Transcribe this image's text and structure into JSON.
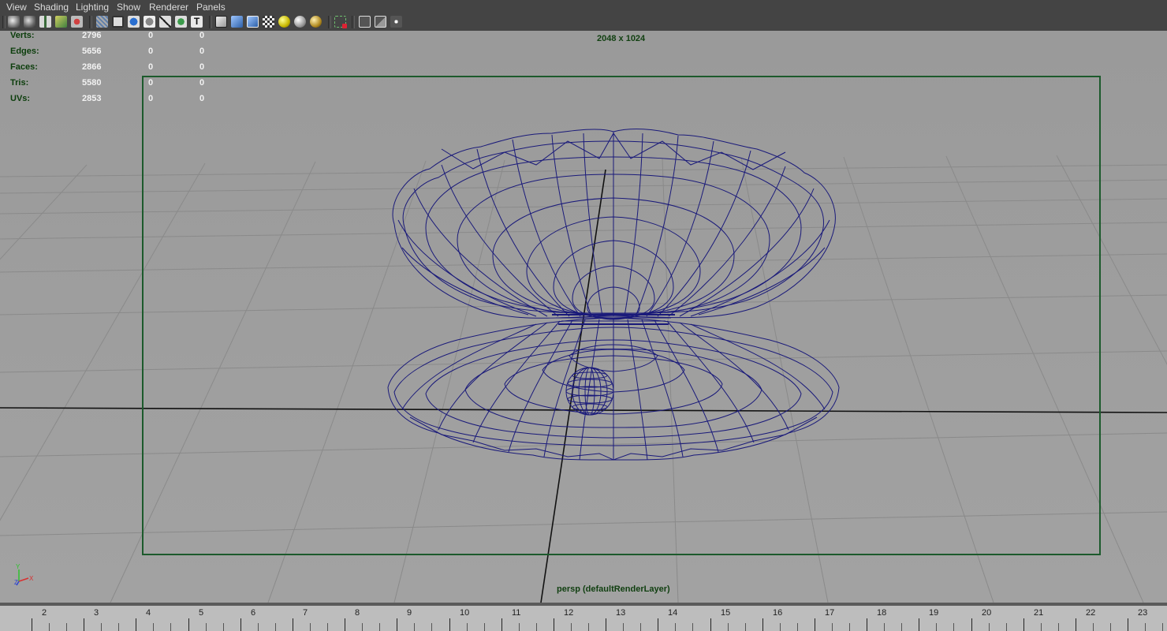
{
  "menu": {
    "items": [
      "View",
      "Shading",
      "Lighting",
      "Show",
      "Renderer",
      "Panels"
    ]
  },
  "toolbar": {
    "icons": [
      "select-camera-icon",
      "camera-attributes-icon",
      "bookmarks-icon",
      "image-plane-icon",
      "two-d-pan-zoom-icon",
      "grid-icon",
      "film-gate-icon",
      "resolution-gate-icon",
      "gate-mask-icon",
      "field-chart-icon",
      "safe-action-icon",
      "safe-title-icon",
      "wireframe-icon",
      "smooth-shade-icon",
      "wireframe-on-shaded-icon",
      "textured-icon",
      "default-light-icon",
      "shadows-icon",
      "ambient-occlusion-icon",
      "isolate-select-icon",
      "xray-icon",
      "xray-joints-icon",
      "xray-components-icon"
    ]
  },
  "hud": {
    "rows": [
      {
        "label": "Verts:",
        "a": "2796",
        "b": "0",
        "c": "0"
      },
      {
        "label": "Edges:",
        "a": "5656",
        "b": "0",
        "c": "0"
      },
      {
        "label": "Faces:",
        "a": "2866",
        "b": "0",
        "c": "0"
      },
      {
        "label": "Tris:",
        "a": "5580",
        "b": "0",
        "c": "0"
      },
      {
        "label": "UVs:",
        "a": "2853",
        "b": "0",
        "c": "0"
      }
    ],
    "resolution": "2048 x 1024",
    "camera": "persp (defaultRenderLayer)"
  },
  "axis_indicator": {
    "y": "Y",
    "x": "X",
    "z": "Z"
  },
  "timeline": {
    "ticks": [
      "2",
      "3",
      "4",
      "5",
      "6",
      "7",
      "8",
      "9",
      "10",
      "11",
      "12",
      "13",
      "14",
      "15",
      "16",
      "17",
      "18",
      "19",
      "20",
      "21",
      "22",
      "23"
    ]
  },
  "colors": {
    "menubar": "#444444",
    "viewport_bg": "#9e9e9e",
    "gate_border": "#1c5a2c",
    "wireframe": "#1a1a7a",
    "hud_label": "#0b3d0b",
    "hud_value": "#f2f2f2"
  }
}
